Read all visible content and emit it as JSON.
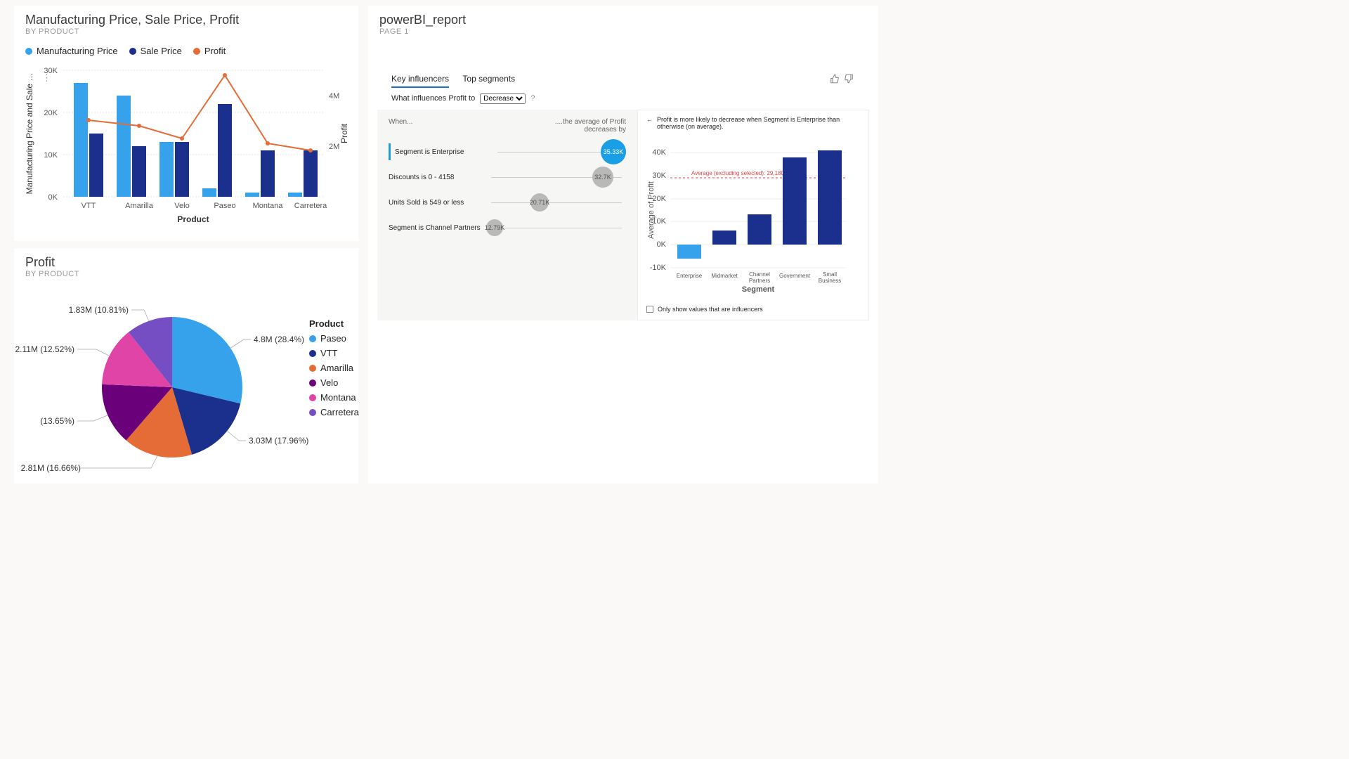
{
  "combo": {
    "title": "Manufacturing Price, Sale Price, Profit",
    "subtitle": "BY PRODUCT",
    "legend": {
      "a": "Manufacturing Price",
      "b": "Sale Price",
      "c": "Profit"
    },
    "xlabel": "Product",
    "ylabel_left": "Manufacturing Price and Sale …",
    "ylabel_right": "Profit",
    "ticks_left": [
      "0K",
      "10K",
      "20K",
      "30K"
    ],
    "ticks_right": [
      "2M",
      "4M"
    ],
    "categories": [
      "VTT",
      "Amarilla",
      "Velo",
      "Paseo",
      "Montana",
      "Carretera"
    ]
  },
  "pie": {
    "title": "Profit",
    "subtitle": "BY PRODUCT",
    "legend_title": "Product",
    "labels": {
      "paseo": "4.8M (28.4%)",
      "vtt": "3.03M (17.96%)",
      "amarilla": "2.81M (16.66%)",
      "velo": "(13.65%)",
      "montana": "2.11M (12.52%)",
      "carretera": "1.83M (10.81%)"
    },
    "legend_items": [
      "Paseo",
      "VTT",
      "Amarilla",
      "Velo",
      "Montana",
      "Carretera"
    ]
  },
  "report": {
    "title": "powerBI_report",
    "subtitle": "PAGE 1"
  },
  "ki": {
    "tab1": "Key influencers",
    "tab2": "Top segments",
    "question": "What influences Profit to",
    "select": "Decrease",
    "help": "?",
    "left_header": "When...",
    "right_header": "....the average of Profit decreases by",
    "rows": [
      {
        "label": "Segment is Enterprise",
        "bubble": "35.33K"
      },
      {
        "label": "Discounts is 0 - 4158",
        "bubble": "32.7K"
      },
      {
        "label": "Units Sold is 549 or less",
        "bubble": "20.71K"
      },
      {
        "label": "Segment is Channel Partners",
        "bubble": "12.79K"
      }
    ],
    "detail_back": "←",
    "detail_text": "Profit is more likely to decrease when Segment is Enterprise than otherwise (on average).",
    "detail_ylabel": "Average of Profit",
    "detail_xlabel": "Segment",
    "detail_avg_label": "Average (excluding selected): 29,180.41",
    "detail_ticks": [
      "-10K",
      "0K",
      "10K",
      "20K",
      "30K",
      "40K"
    ],
    "detail_cats": [
      "Enterprise",
      "Midmarket",
      "Channel Partners",
      "Government",
      "Small Business"
    ],
    "checkbox": "Only show values that are influencers"
  },
  "colors": {
    "blue_light": "#35a2eb",
    "blue_dark": "#1b2f8c",
    "orange": "#e66c37",
    "purple": "#6b007b",
    "pink": "#e044a7",
    "violet": "#744ec2",
    "selected": "#1a9ee5",
    "grey_bubble": "#b9b9b8"
  },
  "chart_data": [
    {
      "type": "bar+line",
      "title": "Manufacturing Price, Sale Price, Profit by Product",
      "xlabel": "Product",
      "ylabel": "Manufacturing Price and Sale Price (K)",
      "y2label": "Profit (M)",
      "categories": [
        "VTT",
        "Amarilla",
        "Velo",
        "Paseo",
        "Montana",
        "Carretera"
      ],
      "series": [
        {
          "name": "Manufacturing Price",
          "axis": "left",
          "values": [
            27,
            24,
            13,
            2,
            1,
            1
          ]
        },
        {
          "name": "Sale Price",
          "axis": "left",
          "values": [
            15,
            12,
            13,
            22,
            11,
            11
          ]
        },
        {
          "name": "Profit",
          "axis": "right",
          "type": "line",
          "values": [
            3.03,
            2.81,
            2.31,
            4.8,
            2.11,
            1.83
          ]
        }
      ],
      "ylim_left": [
        0,
        30
      ],
      "ylim_right": [
        0,
        5
      ]
    },
    {
      "type": "pie",
      "title": "Profit by Product",
      "series": [
        {
          "name": "Paseo",
          "value": 4.8,
          "pct": 28.4
        },
        {
          "name": "VTT",
          "value": 3.03,
          "pct": 17.96
        },
        {
          "name": "Amarilla",
          "value": 2.81,
          "pct": 16.66
        },
        {
          "name": "Velo",
          "value": 2.31,
          "pct": 13.65
        },
        {
          "name": "Montana",
          "value": 2.11,
          "pct": 12.52
        },
        {
          "name": "Carretera",
          "value": 1.83,
          "pct": 10.81
        }
      ]
    },
    {
      "type": "bubble-rank",
      "title": "Key influencers: What influences Profit to Decrease",
      "series": [
        {
          "name": "Segment is Enterprise",
          "value": 35.33,
          "selected": true
        },
        {
          "name": "Discounts is 0 - 4158",
          "value": 32.7
        },
        {
          "name": "Units Sold is 549 or less",
          "value": 20.71
        },
        {
          "name": "Segment is Channel Partners",
          "value": 12.79
        }
      ]
    },
    {
      "type": "bar",
      "title": "Average of Profit by Segment (Enterprise selected)",
      "xlabel": "Segment",
      "ylabel": "Average of Profit",
      "categories": [
        "Enterprise",
        "Midmarket",
        "Channel Partners",
        "Government",
        "Small Business"
      ],
      "values": [
        -6,
        6,
        13,
        38,
        41
      ],
      "reference_line": {
        "label": "Average (excluding selected)",
        "value": 29.18
      },
      "ylim": [
        -10,
        45
      ],
      "highlight_index": 0
    }
  ]
}
